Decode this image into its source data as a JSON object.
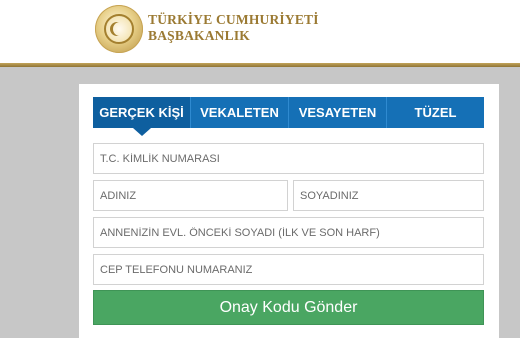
{
  "header": {
    "brand_line1": "TÜRKİYE CUMHURİYETİ",
    "brand_line2": "BAŞBAKANLIK"
  },
  "tabs": [
    {
      "label": "GERÇEK KİŞİ",
      "active": true
    },
    {
      "label": "VEKALETEN",
      "active": false
    },
    {
      "label": "VESAYETEN",
      "active": false
    },
    {
      "label": "TÜZEL",
      "active": false
    }
  ],
  "form": {
    "tc_placeholder": "T.C. KİMLİK NUMARASI",
    "name_placeholder": "ADINIZ",
    "surname_placeholder": "SOYADINIZ",
    "mother_placeholder": "ANNENİZİN EVL. ÖNCEKİ SOYADI (İLK VE SON HARF)",
    "phone_placeholder": "CEP TELEFONU NUMARANIZ",
    "submit_label": "Onay Kodu Gönder"
  },
  "colors": {
    "tab_bar": "#1570b6",
    "tab_active": "#0e5f9f",
    "submit": "#4aa662",
    "brand_gold": "#9b7a33",
    "background": "#c7c7c7"
  }
}
